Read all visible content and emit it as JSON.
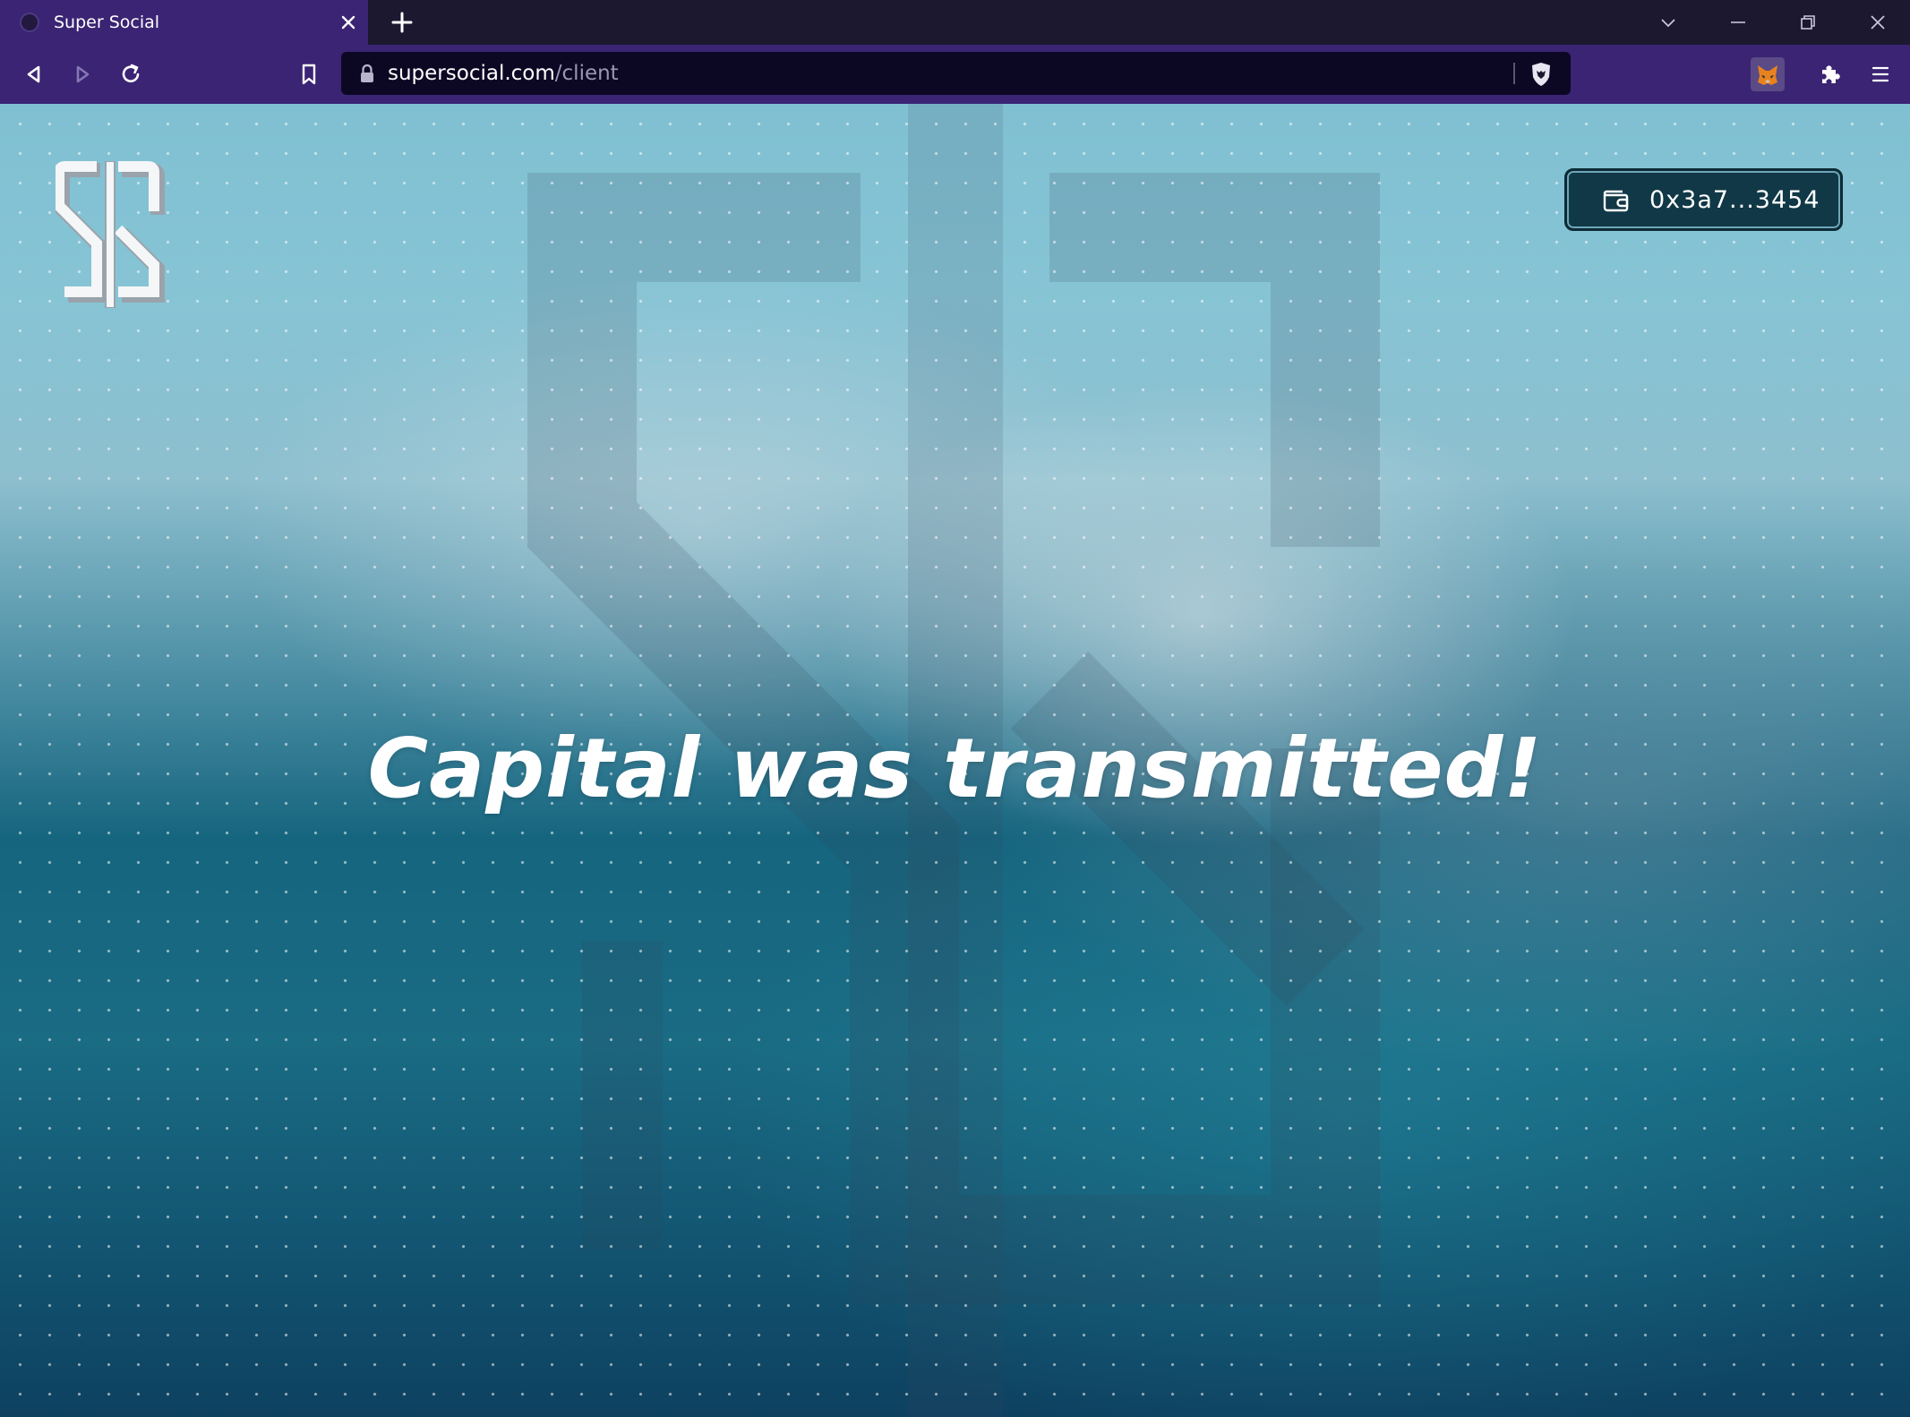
{
  "browser": {
    "tab": {
      "title": "Super Social",
      "favicon": "super-social-favicon",
      "close_icon": "close-icon"
    },
    "new_tab_icon": "plus-icon",
    "window_controls": [
      "chevron-down-icon",
      "minimize-icon",
      "restore-icon",
      "close-icon"
    ],
    "nav_icons": [
      "back-icon",
      "forward-icon",
      "reload-icon",
      "bookmark-icon"
    ],
    "address_bar": {
      "host": "supersocial.com",
      "path": "/client",
      "lock_icon": "lock-icon",
      "shield_icon": "brave-shield-icon"
    },
    "extensions": [
      "metamask-fox-icon",
      "puzzle-icon",
      "menu-icon"
    ],
    "colors": {
      "tab_strip": "#1b1830",
      "toolbar": "#3a2473",
      "omnibox": "#0c0824"
    }
  },
  "page": {
    "logo": "super-social-dollar-logo",
    "wallet": {
      "icon": "wallet-icon",
      "address": "0x3a7...3454"
    },
    "headline": "Capital was transmitted!",
    "colors": {
      "sky_top": "#7fc0d2",
      "sea_bottom": "#0e4160",
      "wallet_button": "#113846"
    }
  }
}
